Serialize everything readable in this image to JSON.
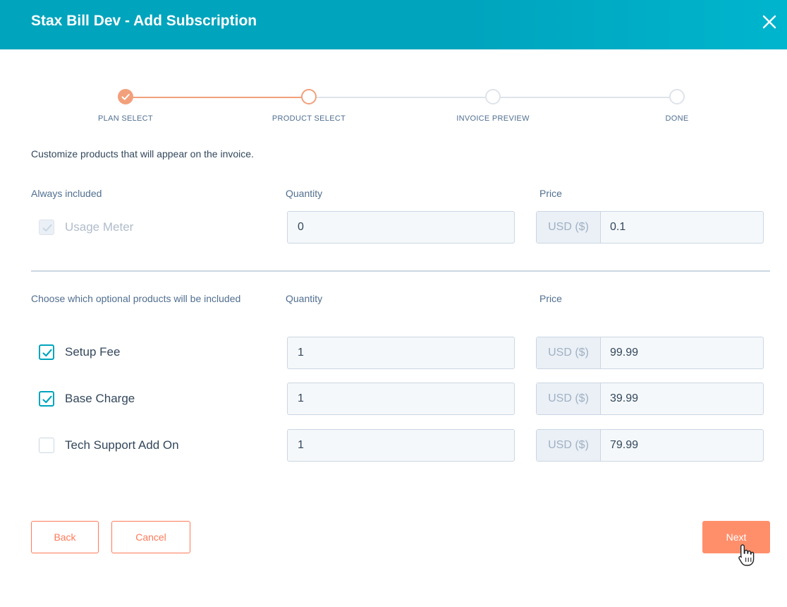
{
  "header": {
    "title": "Stax Bill Dev - Add Subscription"
  },
  "stepper": {
    "steps": [
      {
        "label": "PLAN SELECT",
        "state": "complete"
      },
      {
        "label": "PRODUCT SELECT",
        "state": "current"
      },
      {
        "label": "INVOICE PREVIEW",
        "state": "upcoming"
      },
      {
        "label": "DONE",
        "state": "upcoming"
      }
    ]
  },
  "intro": "Customize products that will appear on the invoice.",
  "always_included": {
    "heading": "Always included",
    "quantity_label": "Quantity",
    "price_label": "Price",
    "items": [
      {
        "name": "Usage Meter",
        "checked": true,
        "disabled": true,
        "quantity": "0",
        "currency": "USD ($)",
        "price": "0.1"
      }
    ]
  },
  "optional": {
    "heading": "Choose which optional products will be included",
    "quantity_label": "Quantity",
    "price_label": "Price",
    "items": [
      {
        "name": "Setup Fee",
        "checked": true,
        "quantity": "1",
        "currency": "USD ($)",
        "price": "99.99"
      },
      {
        "name": "Base Charge",
        "checked": true,
        "quantity": "1",
        "currency": "USD ($)",
        "price": "39.99"
      },
      {
        "name": "Tech Support Add On",
        "checked": false,
        "quantity": "1",
        "currency": "USD ($)",
        "price": "79.99"
      }
    ]
  },
  "buttons": {
    "back": "Back",
    "cancel": "Cancel",
    "next": "Next"
  },
  "colors": {
    "header": "#00a4bd",
    "accent": "#ff7a59",
    "checkbox": "#00a4bd"
  }
}
